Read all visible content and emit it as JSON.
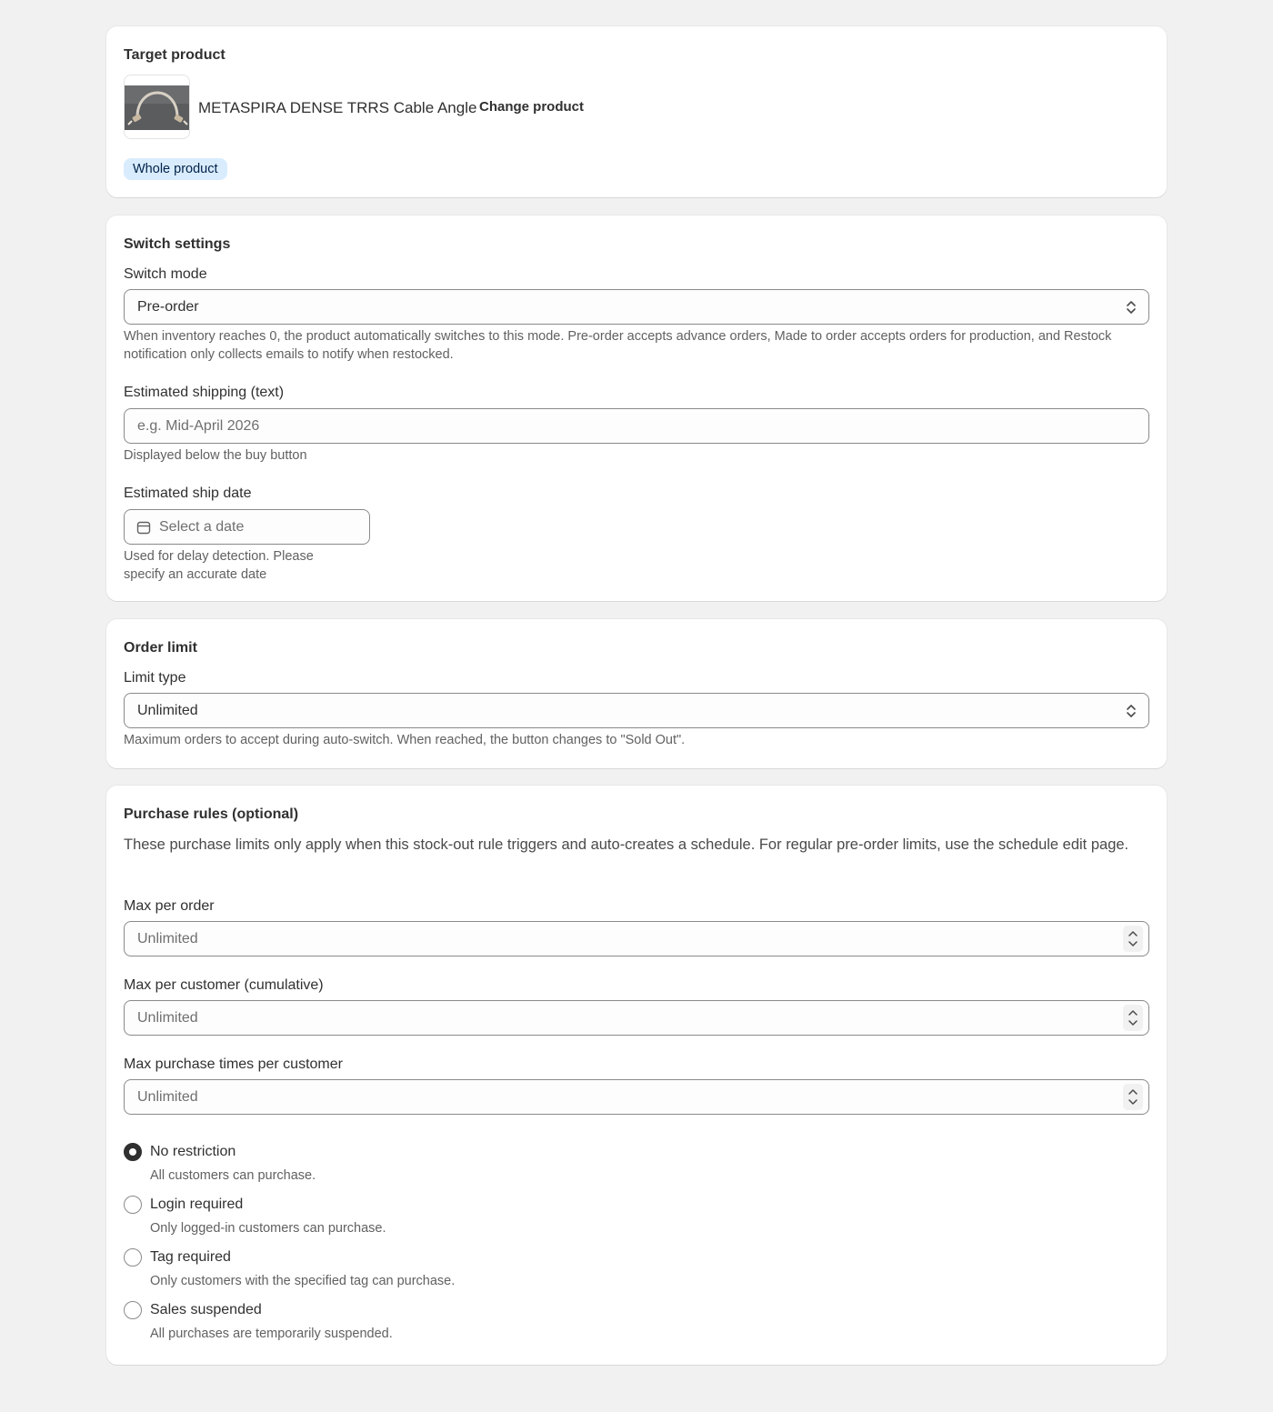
{
  "target_product": {
    "title": "Target product",
    "product_name": "METASPIRA DENSE TRRS Cable Angle",
    "change_button": "Change product",
    "scope_badge": "Whole product",
    "thumbnail_icon": "cable-thumbnail"
  },
  "switch_settings": {
    "title": "Switch settings",
    "mode_label": "Switch mode",
    "mode_value": "Pre-order",
    "mode_help": "When inventory reaches 0, the product automatically switches to this mode. Pre-order accepts advance orders, Made to order accepts orders for production, and Restock notification only collects emails to notify when restocked.",
    "shipping_label": "Estimated shipping (text)",
    "shipping_placeholder": "e.g. Mid-April 2026",
    "shipping_help": "Displayed below the buy button",
    "ship_date_label": "Estimated ship date",
    "ship_date_placeholder": "Select a date",
    "ship_date_help": "Used for delay detection. Please specify an accurate date"
  },
  "order_limit": {
    "title": "Order limit",
    "limit_label": "Limit type",
    "limit_value": "Unlimited",
    "limit_help": "Maximum orders to accept during auto-switch. When reached, the button changes to \"Sold Out\"."
  },
  "purchase_rules": {
    "title": "Purchase rules (optional)",
    "description": "These purchase limits only apply when this stock-out rule triggers and auto-creates a schedule. For regular pre-order limits, use the schedule edit page.",
    "max_per_order_label": "Max per order",
    "max_per_order_placeholder": "Unlimited",
    "max_per_customer_label": "Max per customer (cumulative)",
    "max_per_customer_placeholder": "Unlimited",
    "max_times_label": "Max purchase times per customer",
    "max_times_placeholder": "Unlimited",
    "options": [
      {
        "label": "No restriction",
        "help": "All customers can purchase.",
        "checked": true
      },
      {
        "label": "Login required",
        "help": "Only logged-in customers can purchase.",
        "checked": false
      },
      {
        "label": "Tag required",
        "help": "Only customers with the specified tag can purchase.",
        "checked": false
      },
      {
        "label": "Sales suspended",
        "help": "All purchases are temporarily suspended.",
        "checked": false
      }
    ]
  },
  "colors": {
    "page_bg": "#f1f1f1",
    "card_bg": "#ffffff",
    "badge_bg": "#d9ecfd",
    "text": "#303030",
    "subdued": "#616161"
  }
}
